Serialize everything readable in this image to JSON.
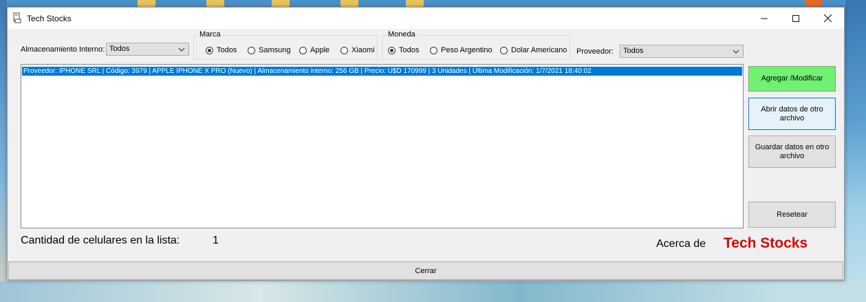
{
  "window": {
    "title": "Tech Stocks"
  },
  "filters": {
    "storage": {
      "label": "Almacenamiento Interno:",
      "value": "Todos"
    },
    "brand": {
      "title": "Marca",
      "options": [
        "Todos",
        "Samsung",
        "Apple",
        "Xiaomi"
      ],
      "selected": "Todos"
    },
    "currency": {
      "title": "Moneda",
      "options": [
        "Todos",
        "Peso Argentino",
        "Dolar Americano"
      ],
      "selected": "Todos"
    },
    "provider": {
      "label": "Proveedor:",
      "value": "Todos"
    }
  },
  "list": {
    "items": [
      "Proveedor: IPHONE SRL | Código: 3979  |  APPLE IPHONE X PRO (Nuevo)  |  Almacenamiento interno: 256 GB | Precio: U$D 170999  |  3 Unidades |  Última Modificación: 1/7/2021 18:40:02"
    ],
    "selected_index": 0
  },
  "buttons": {
    "add": "Agregar /Modificar",
    "open": "Abrir datos de otro archivo",
    "save": "Guardar datos en otro archivo",
    "reset": "Resetear",
    "close": "Cerrar"
  },
  "footer": {
    "count_label": "Cantidad de celulares en la lista:",
    "count_value": "1",
    "about_label": "Acerca de",
    "about_name": "Tech Stocks"
  },
  "colors": {
    "add_button": "#71f171",
    "selection": "#0078d7",
    "about_name": "#e00000"
  }
}
